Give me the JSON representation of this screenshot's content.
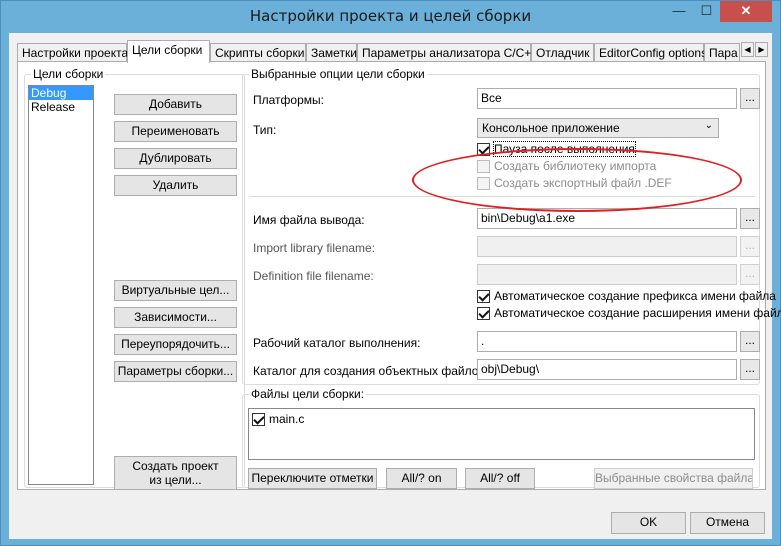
{
  "window": {
    "title": "Настройки проекта и целей сборки",
    "minimize": "—",
    "maximize": "☐",
    "close": "✕"
  },
  "tabs": [
    {
      "label": "Настройки проекта"
    },
    {
      "label": "Цели сборки"
    },
    {
      "label": "Скрипты сборки"
    },
    {
      "label": "Заметки"
    },
    {
      "label": "Параметры анализатора C/C++"
    },
    {
      "label": "Отладчик"
    },
    {
      "label": "EditorConfig options"
    },
    {
      "label": "Пара"
    }
  ],
  "tab_scroll": {
    "left": "◀",
    "right": "▶"
  },
  "targets": {
    "group_title": "Цели сборки",
    "items": [
      "Debug",
      "Release"
    ],
    "buttons": {
      "add": "Добавить",
      "rename": "Переименовать",
      "duplicate": "Дублировать",
      "delete": "Удалить",
      "virtual": "Виртуальные цел...",
      "dependencies": "Зависимости...",
      "reorder": "Переупорядочить...",
      "build_options": "Параметры сборки...",
      "create_project_line1": "Создать проект",
      "create_project_line2": "из цели..."
    }
  },
  "options": {
    "group_title": "Выбранные опции цели сборки",
    "platforms_label": "Платформы:",
    "platforms_value": "Все",
    "type_label": "Тип:",
    "type_value": "Консольное приложение",
    "pause_label": "Пауза после выполнения",
    "pause_checked": true,
    "import_lib_cb_label": "Создать библиотеку импорта",
    "export_def_label": "Создать экспортный файл .DEF",
    "output_label": "Имя файла вывода:",
    "output_value": "bin\\Debug\\a1.exe",
    "import_lib_label": "Import library filename:",
    "def_file_label": "Definition file filename:",
    "auto_prefix_label": "Автоматическое создание префикса имени файла",
    "auto_ext_label": "Автоматическое создание расширения имени файла",
    "workdir_label": "Рабочий каталог выполнения:",
    "workdir_value": ".",
    "objdir_label": "Каталог для создания объектных файлов:",
    "objdir_value": "obj\\Debug\\",
    "browse": "..."
  },
  "files": {
    "group_title": "Файлы цели сборки:",
    "items": [
      "main.c"
    ],
    "toggle_marks": "Переключите отметки",
    "all_on": "All/? on",
    "all_off": "All/? off",
    "selected_props": "Выбранные свойства файла"
  },
  "dialog": {
    "ok": "OK",
    "cancel": "Отмена"
  }
}
